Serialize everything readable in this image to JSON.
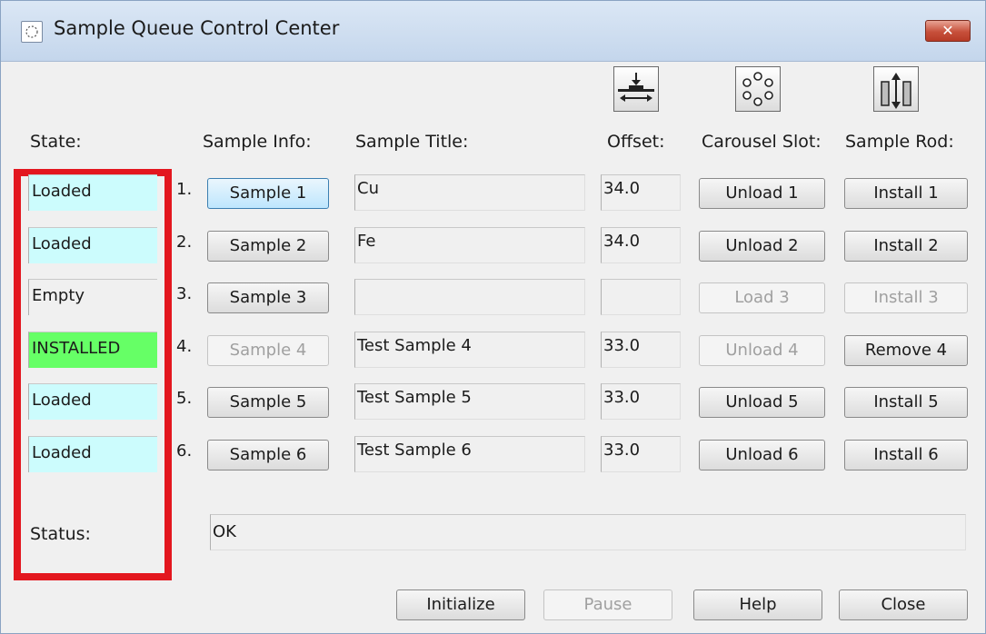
{
  "window": {
    "title": "Sample Queue Control Center",
    "close_label": "✕"
  },
  "headers": {
    "state": "State:",
    "sample_info": "Sample Info:",
    "sample_title": "Sample Title:",
    "offset": "Offset:",
    "carousel_slot": "Carousel Slot:",
    "sample_rod": "Sample Rod:"
  },
  "icons": {
    "offset": "offset-icon",
    "carousel": "carousel-icon",
    "sample_rod": "sample-rod-icon"
  },
  "rows": [
    {
      "num": "1.",
      "state": "Loaded",
      "state_color": "#ccfcfd",
      "info": "Sample 1",
      "info_enabled": true,
      "info_focused": true,
      "title": "Cu",
      "offset": "34.0",
      "carousel": "Unload 1",
      "carousel_enabled": true,
      "rod": "Install 1",
      "rod_enabled": true
    },
    {
      "num": "2.",
      "state": "Loaded",
      "state_color": "#ccfcfd",
      "info": "Sample 2",
      "info_enabled": true,
      "info_focused": false,
      "title": "Fe",
      "offset": "34.0",
      "carousel": "Unload 2",
      "carousel_enabled": true,
      "rod": "Install 2",
      "rod_enabled": true
    },
    {
      "num": "3.",
      "state": "Empty",
      "state_color": "#f0f0f0",
      "info": "Sample 3",
      "info_enabled": true,
      "info_focused": false,
      "title": "",
      "offset": "",
      "carousel": "Load 3",
      "carousel_enabled": false,
      "rod": "Install 3",
      "rod_enabled": false
    },
    {
      "num": "4.",
      "state": "INSTALLED",
      "state_color": "#66ff66",
      "info": "Sample 4",
      "info_enabled": false,
      "info_focused": false,
      "title": "Test Sample 4",
      "offset": "33.0",
      "carousel": "Unload 4",
      "carousel_enabled": false,
      "rod": "Remove 4",
      "rod_enabled": true
    },
    {
      "num": "5.",
      "state": "Loaded",
      "state_color": "#ccfcfd",
      "info": "Sample 5",
      "info_enabled": true,
      "info_focused": false,
      "title": "Test Sample 5",
      "offset": "33.0",
      "carousel": "Unload 5",
      "carousel_enabled": true,
      "rod": "Install 5",
      "rod_enabled": true
    },
    {
      "num": "6.",
      "state": "Loaded",
      "state_color": "#ccfcfd",
      "info": "Sample 6",
      "info_enabled": true,
      "info_focused": false,
      "title": "Test Sample 6",
      "offset": "33.0",
      "carousel": "Unload 6",
      "carousel_enabled": true,
      "rod": "Install 6",
      "rod_enabled": true
    }
  ],
  "status": {
    "label": "Status:",
    "value": "OK"
  },
  "footer": {
    "initialize": "Initialize",
    "pause": "Pause",
    "help": "Help",
    "close": "Close"
  },
  "colors": {
    "highlight_border": "#e3171f",
    "loaded": "#ccfcfd",
    "installed": "#66ff66"
  }
}
